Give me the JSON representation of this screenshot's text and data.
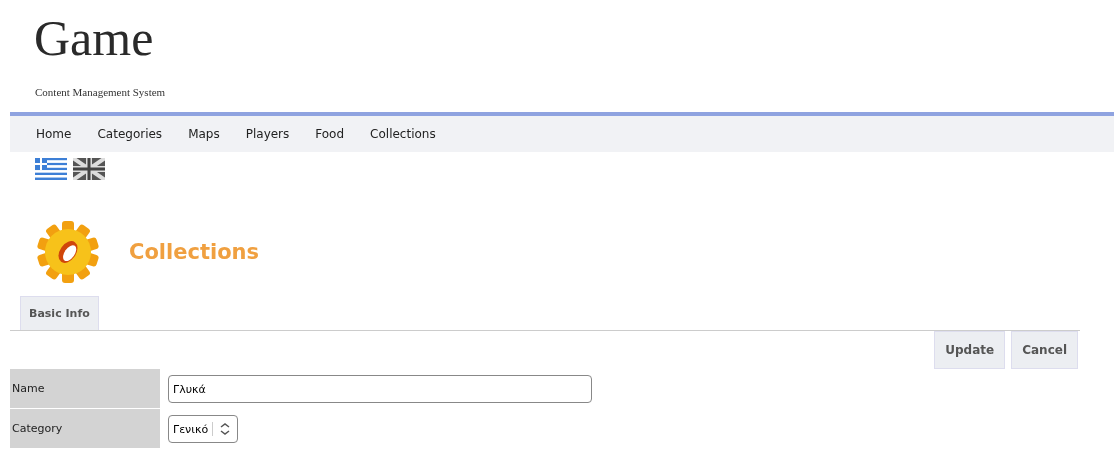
{
  "site": {
    "title": "Game",
    "subtitle": "Content Management System"
  },
  "nav": [
    "Home",
    "Categories",
    "Maps",
    "Players",
    "Food",
    "Collections"
  ],
  "languages": [
    {
      "kind": "greek"
    },
    {
      "kind": "uk"
    }
  ],
  "page": {
    "heading": "Collections"
  },
  "tabs": [
    {
      "label": "Basic Info",
      "selected": true
    }
  ],
  "buttons": [
    "Update",
    "Cancel"
  ],
  "form": [
    {
      "kind": "text",
      "label": "Name",
      "value": "Γλυκά"
    },
    {
      "kind": "select",
      "label": "Category",
      "value": "Γενικό"
    }
  ]
}
